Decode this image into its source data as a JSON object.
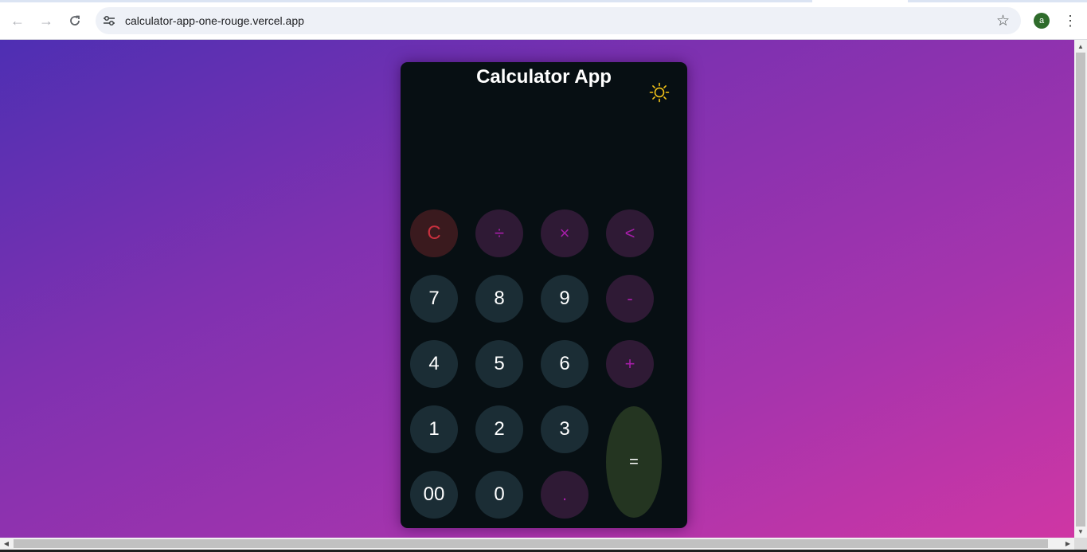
{
  "browser": {
    "url": "calculator-app-one-rouge.vercel.app",
    "profile_initial": "a",
    "icons": {
      "back": "arrow-left-icon",
      "forward": "arrow-right-icon",
      "reload": "reload-icon",
      "site_info": "tune-icon",
      "bookmark": "star-icon",
      "menu": "three-dots-vertical-icon"
    }
  },
  "calculator": {
    "title": "Calculator App",
    "display_value": "",
    "theme_icon": "sun-icon",
    "keys": {
      "clear": "C",
      "divide": "÷",
      "multiply": "×",
      "backspace": "<",
      "seven": "7",
      "eight": "8",
      "nine": "9",
      "minus": "-",
      "four": "4",
      "five": "5",
      "six": "6",
      "plus": "+",
      "one": "1",
      "two": "2",
      "three": "3",
      "equals": "=",
      "double_zero": "00",
      "zero": "0",
      "decimal": "."
    }
  },
  "colors": {
    "background_gradient": [
      "#4e2fb3",
      "#cf36a4"
    ],
    "calculator_bg": "#070f13",
    "number_key": "#1b2d35",
    "operator_key": "#2f1a35",
    "operator_text": "#a61ea8",
    "clear_key": "#3a1a1e",
    "clear_text": "#c8303e",
    "equals_key": "#243521",
    "sun": "#f5c518"
  }
}
